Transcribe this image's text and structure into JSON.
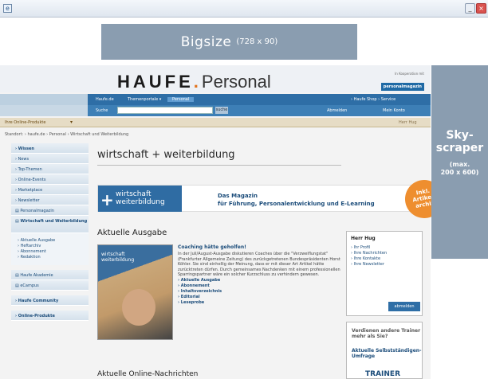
{
  "ads": {
    "bigsize_title": "Bigsize",
    "bigsize_size": "(728 x 90)",
    "skyscraper_title_1": "Sky-",
    "skyscraper_title_2": "scraper",
    "skyscraper_size_1": "(max.",
    "skyscraper_size_2": "200 x 600)"
  },
  "site": {
    "logo_haufe": "HAUFE",
    "logo_dot": ".",
    "logo_personal": "Personal",
    "logo_in_kooperation": "In Kooperation mit",
    "logo_personalmagazin": "personalmagazin",
    "nav1": [
      "Haufe.de",
      "Themenportale ▾",
      "Personal"
    ],
    "nav1_right": "› Haufe Shop  › Service",
    "search_label": "Suche",
    "search_button": "suche",
    "abmelden": "Abmelden",
    "mein_konto": "Mein Konto",
    "produkte_label": "Ihre Online-Produkte",
    "user_right": "Herr Hug",
    "breadcrumb": "Standort:  › haufe.de  › Personal  › Wirtschaft und Weiterbildung",
    "headline": "wirtschaft + weiterbildung"
  },
  "sidebar": {
    "items": [
      "› Wissen",
      "› News",
      "› Top-Themen",
      "› Online-Events",
      "› Marketplace",
      "› Newsletter",
      "Personalmagazin",
      "Wirtschaft und Weiterbildung"
    ],
    "sub": [
      "› Aktuelle Ausgabe",
      "› Heftarchiv",
      "› Abonnement",
      "› Redaktion"
    ],
    "extra": [
      "Haufe Akademie",
      "eCampus",
      "› Haufe Community",
      "› Online-Produkte"
    ]
  },
  "banner": {
    "left_1": "wirtschaft",
    "left_2": "weiterbildung",
    "mag_1": "Das Magazin",
    "mag_2": "für Führung, Personalentwicklung und E-Learning",
    "badge_1": "Inkl.",
    "badge_2": "Artikel-",
    "badge_3": "archiv"
  },
  "ausgabe": {
    "heading": "Aktuelle Ausgabe",
    "cover_title_1": "wirtschaft",
    "cover_title_2": "weiterbildung",
    "article_title": "Coaching hätte geholfen!",
    "article_text": "In der Juli/August-Ausgabe diskutieren Coaches über die \"Verzweiflungstat\" (Frankfurter Allgemeine Zeitung) des zurückgetretenen Bundespräsidenten Horst Köhler. Sie sind einhellig der Meinung, dass er mit dieser Art Artikel hätte zurücktreten dürfen. Durch gemeinsames Nachdenken mit einem professionellen Sparringspartner wäre ein solcher Kurzschluss zu verhindern gewesen.",
    "links": [
      "› Aktuelle Ausgabe",
      "› Abonnement",
      "› Inhaltsverzeichnis",
      "› Editorial",
      "› Leseprobe"
    ]
  },
  "hug_box": {
    "title": "Herr Hug",
    "links": [
      "› Ihr Profil",
      "› Ihre Nachrichten",
      "› Ihre Kontakte",
      "› Ihre Newsletter"
    ],
    "abmelden": "abmelden"
  },
  "trainer_box": {
    "question": "Verdienen andere Trainer mehr als Sie?",
    "answer": "Aktuelle Selbstständigen-Umfrage",
    "logo": "TRAINER"
  },
  "online": {
    "heading": "Aktuelle Online-Nachrichten"
  }
}
